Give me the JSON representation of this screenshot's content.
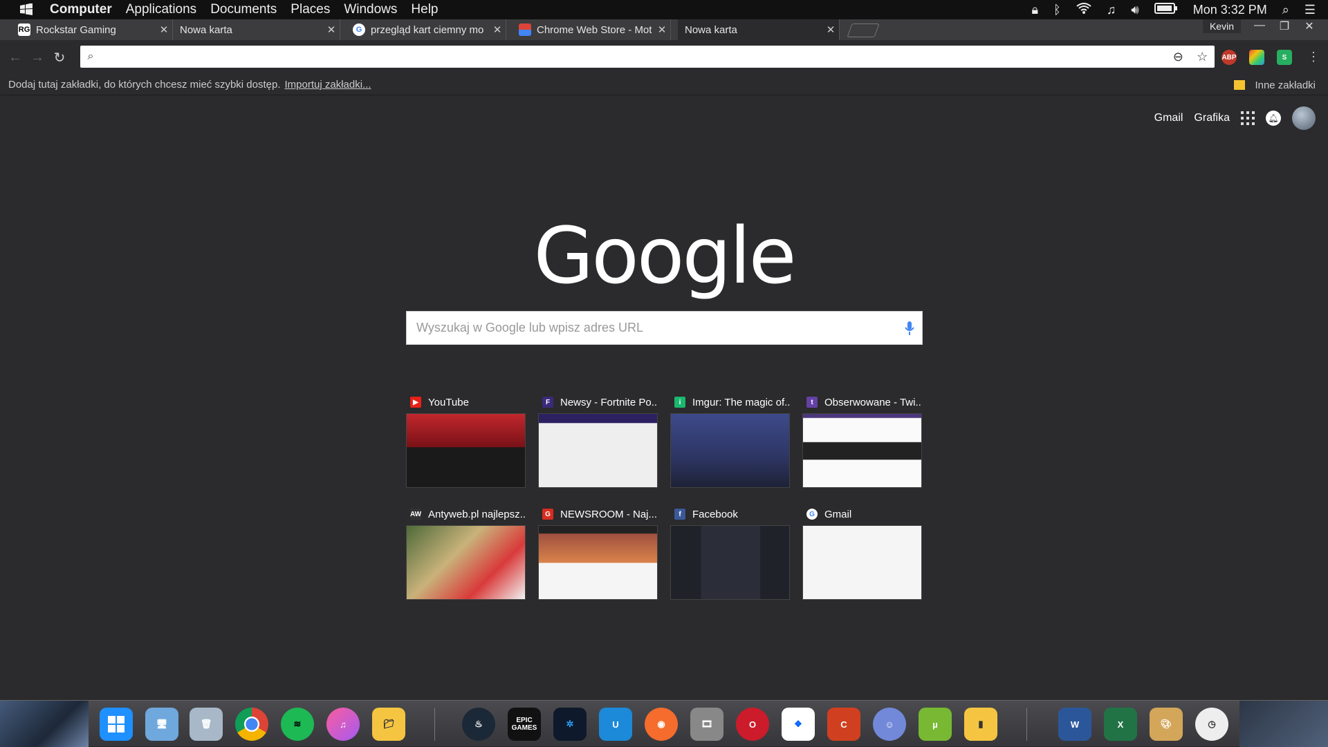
{
  "menubar": {
    "items": [
      "Computer",
      "Applications",
      "Documents",
      "Places",
      "Windows",
      "Help"
    ],
    "clock": "Mon 3:32 PM"
  },
  "tabs": [
    {
      "title": "Rockstar Gaming",
      "favicon": "RG"
    },
    {
      "title": "Nowa karta",
      "favicon": ""
    },
    {
      "title": "przegląd kart ciemny mo",
      "favicon": "G"
    },
    {
      "title": "Chrome Web Store - Mot",
      "favicon": "CWS"
    },
    {
      "title": "Nowa karta",
      "favicon": ""
    }
  ],
  "profile_name": "Kevin",
  "omnibox": {
    "value": ""
  },
  "extensions": [
    "ABP",
    "colorpicker",
    "S"
  ],
  "bookmarks": {
    "hint": "Dodaj tutaj zakładki, do których chcesz mieć szybki dostęp.",
    "import_link": "Importuj zakładki...",
    "other": "Inne zakładki"
  },
  "top_links": {
    "gmail": "Gmail",
    "images": "Grafika"
  },
  "logo": "Google",
  "search": {
    "placeholder": "Wyszukaj w Google lub wpisz adres URL"
  },
  "tiles": [
    {
      "title": "YouTube",
      "icon": "youtube-icon",
      "color": "#e62117"
    },
    {
      "title": "Newsy - Fortnite Po...",
      "icon": "fortnite-icon",
      "color": "#3b2a7a"
    },
    {
      "title": "Imgur: The magic of...",
      "icon": "imgur-icon",
      "color": "#1bb76e"
    },
    {
      "title": "Obserwowane - Twi...",
      "icon": "twitch-icon",
      "color": "#6441a5"
    },
    {
      "title": "Antyweb.pl najlepsz...",
      "icon": "antyweb-icon",
      "color": "#333333"
    },
    {
      "title": "NEWSROOM - Naj...",
      "icon": "g-news-icon",
      "color": "#d62d20"
    },
    {
      "title": "Facebook",
      "icon": "facebook-icon",
      "color": "#3b5998"
    },
    {
      "title": "Gmail",
      "icon": "google-icon",
      "color": "#ffffff"
    }
  ],
  "dock": {
    "epic_label": "EPIC GAMES"
  }
}
